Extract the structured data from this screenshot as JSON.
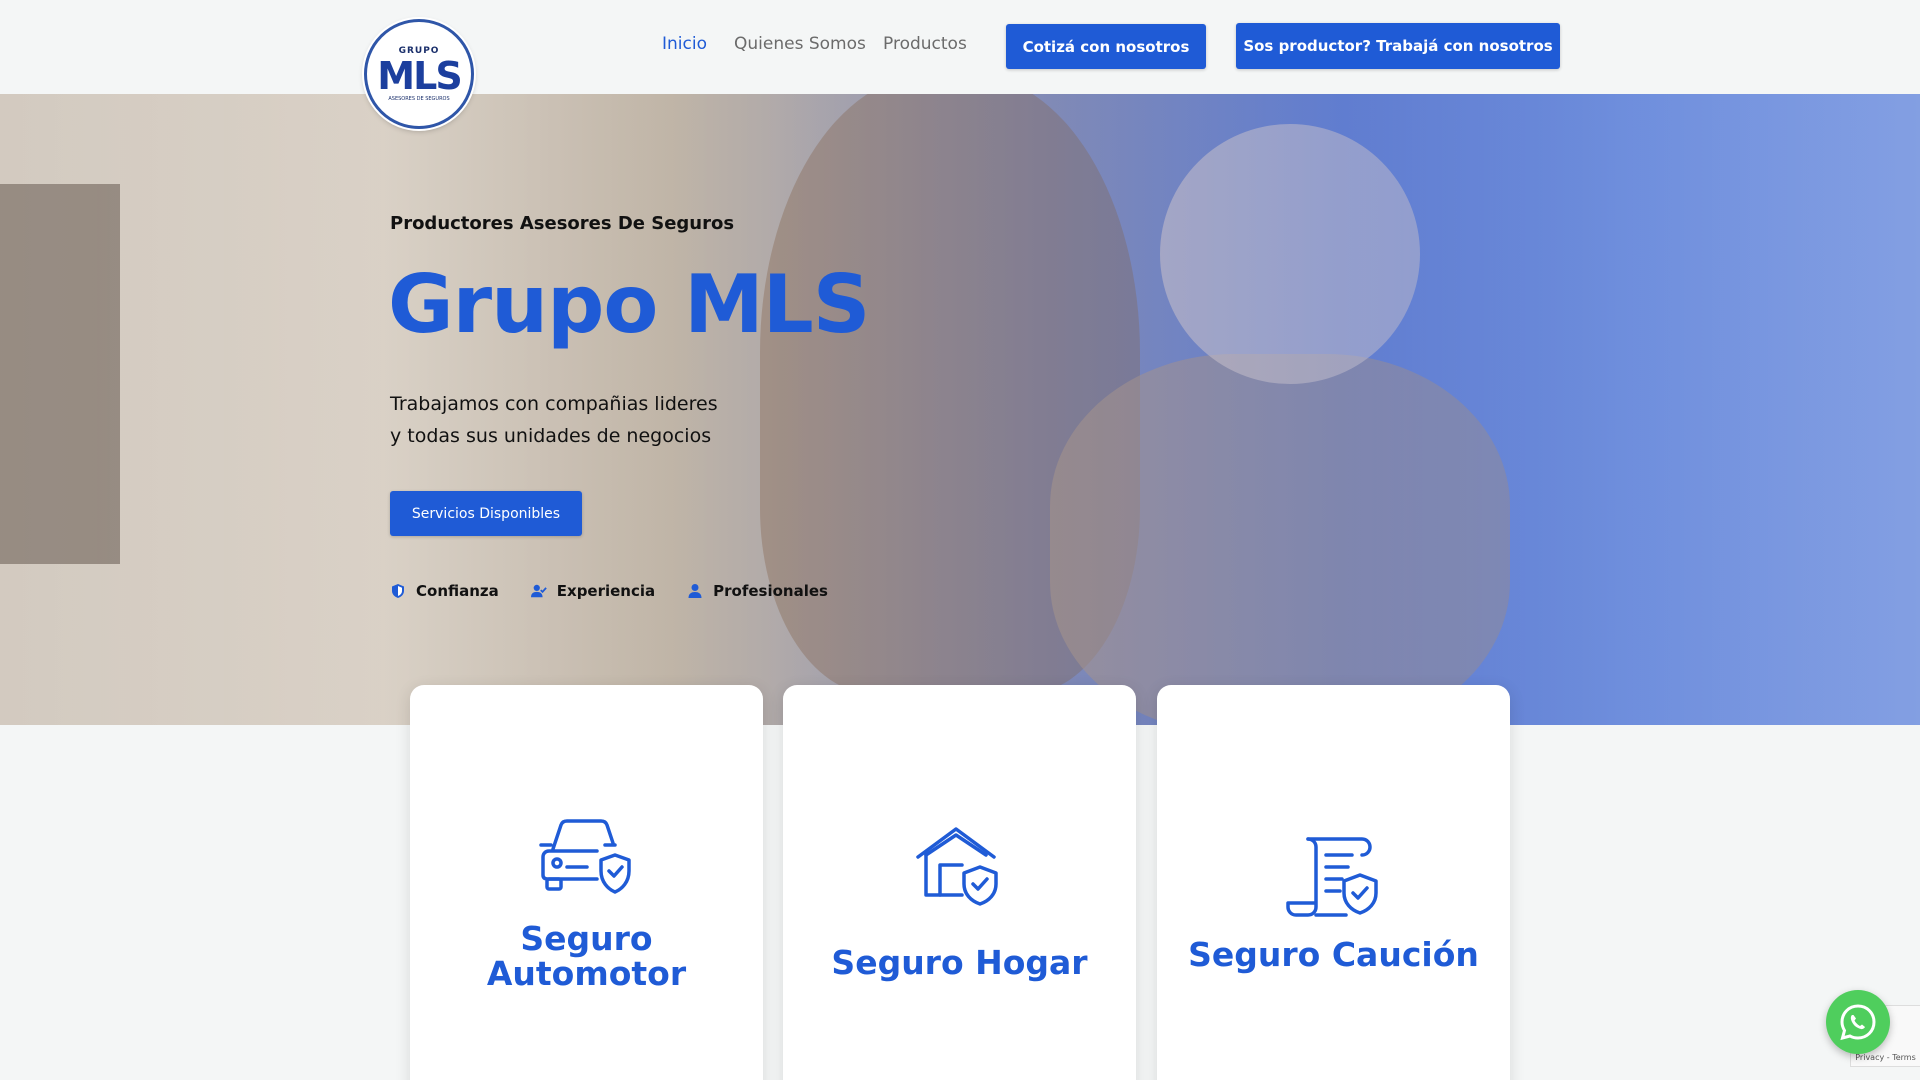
{
  "brand": {
    "logo_top": "GRUPO",
    "logo_main": "MLS",
    "logo_bottom": "ASESORES DE SEGUROS"
  },
  "nav": {
    "items": [
      {
        "label": "Inicio",
        "active": true
      },
      {
        "label": "Quienes Somos",
        "active": false
      },
      {
        "label": "Productos",
        "active": false
      }
    ],
    "cta_quote": "Cotizá con nosotros",
    "cta_producer": "Sos productor? Trabajá con nosotros"
  },
  "hero": {
    "eyebrow": "Productores Asesores De Seguros",
    "title": "Grupo MLS",
    "subtitle_line1": "Trabajamos con compañias lideres",
    "subtitle_line2": "y todas sus unidades de negocios",
    "button": "Servicios Disponibles",
    "features": [
      {
        "icon": "shield-icon",
        "label": "Confianza"
      },
      {
        "icon": "user-check-icon",
        "label": "Experiencia"
      },
      {
        "icon": "user-icon",
        "label": "Profesionales"
      }
    ]
  },
  "cards": [
    {
      "icon": "car-shield-icon",
      "title": "Seguro Automotor"
    },
    {
      "icon": "house-shield-icon",
      "title": "Seguro Hogar"
    },
    {
      "icon": "document-shield-icon",
      "title": "Seguro Caución"
    }
  ],
  "recaptcha": {
    "text": "Privacy - Terms"
  },
  "colors": {
    "accent": "#1f5bd6",
    "whatsapp": "#4fce5d",
    "background": "#f4f6f6"
  }
}
